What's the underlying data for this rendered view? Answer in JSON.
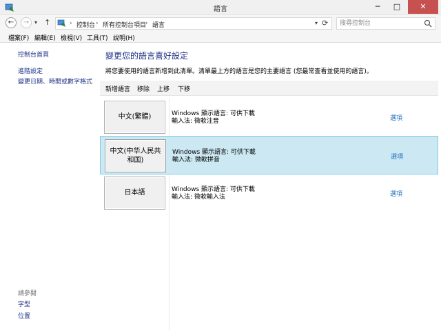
{
  "window": {
    "title": "語言",
    "minimize": "─",
    "maximize": "□",
    "close": "✕"
  },
  "nav": {
    "back": "←",
    "forward": "→",
    "history": "▾",
    "up": "↑"
  },
  "breadcrumb": [
    "控制台",
    "所有控制台項目",
    "語言"
  ],
  "breadcrumb_sep": "›",
  "search": {
    "placeholder": "搜尋控制台"
  },
  "menu": [
    "檔案(F)",
    "編輯(E)",
    "檢視(V)",
    "工具(T)",
    "說明(H)"
  ],
  "sidebar": {
    "home": "控制台首頁",
    "links": [
      "進階設定",
      "變更日期、時間或數字格式"
    ],
    "see_also": "請參閱",
    "see_also_links": [
      "字型",
      "位置"
    ]
  },
  "content": {
    "title": "變更您的語言喜好設定",
    "description": "將您要使用的語言新增到此清單。清單最上方的語言是您的主要語言 (您最常查看並使用的語言)。",
    "toolbar": [
      "新增語言",
      "移除",
      "上移",
      "下移"
    ],
    "languages": [
      {
        "name": "中文(繁體)",
        "display": "Windows 顯示語言: 可供下載",
        "input": "輸入法: 微軟注音",
        "options": "選項",
        "selected": false
      },
      {
        "name": "中文(中华人民共和国)",
        "display": "Windows 顯示語言: 可供下載",
        "input": "輸入法: 微軟拼音",
        "options": "選項",
        "selected": true
      },
      {
        "name": "日本語",
        "display": "Windows 顯示語言: 可供下載",
        "input": "輸入法: 微軟輸入法",
        "options": "選項",
        "selected": false
      }
    ]
  },
  "colors": {
    "link": "#1e3287",
    "options_link": "#1e6fc1",
    "selected_row": "#cce8f3",
    "selected_border": "#7ec8e8",
    "close_button": "#c75050"
  }
}
